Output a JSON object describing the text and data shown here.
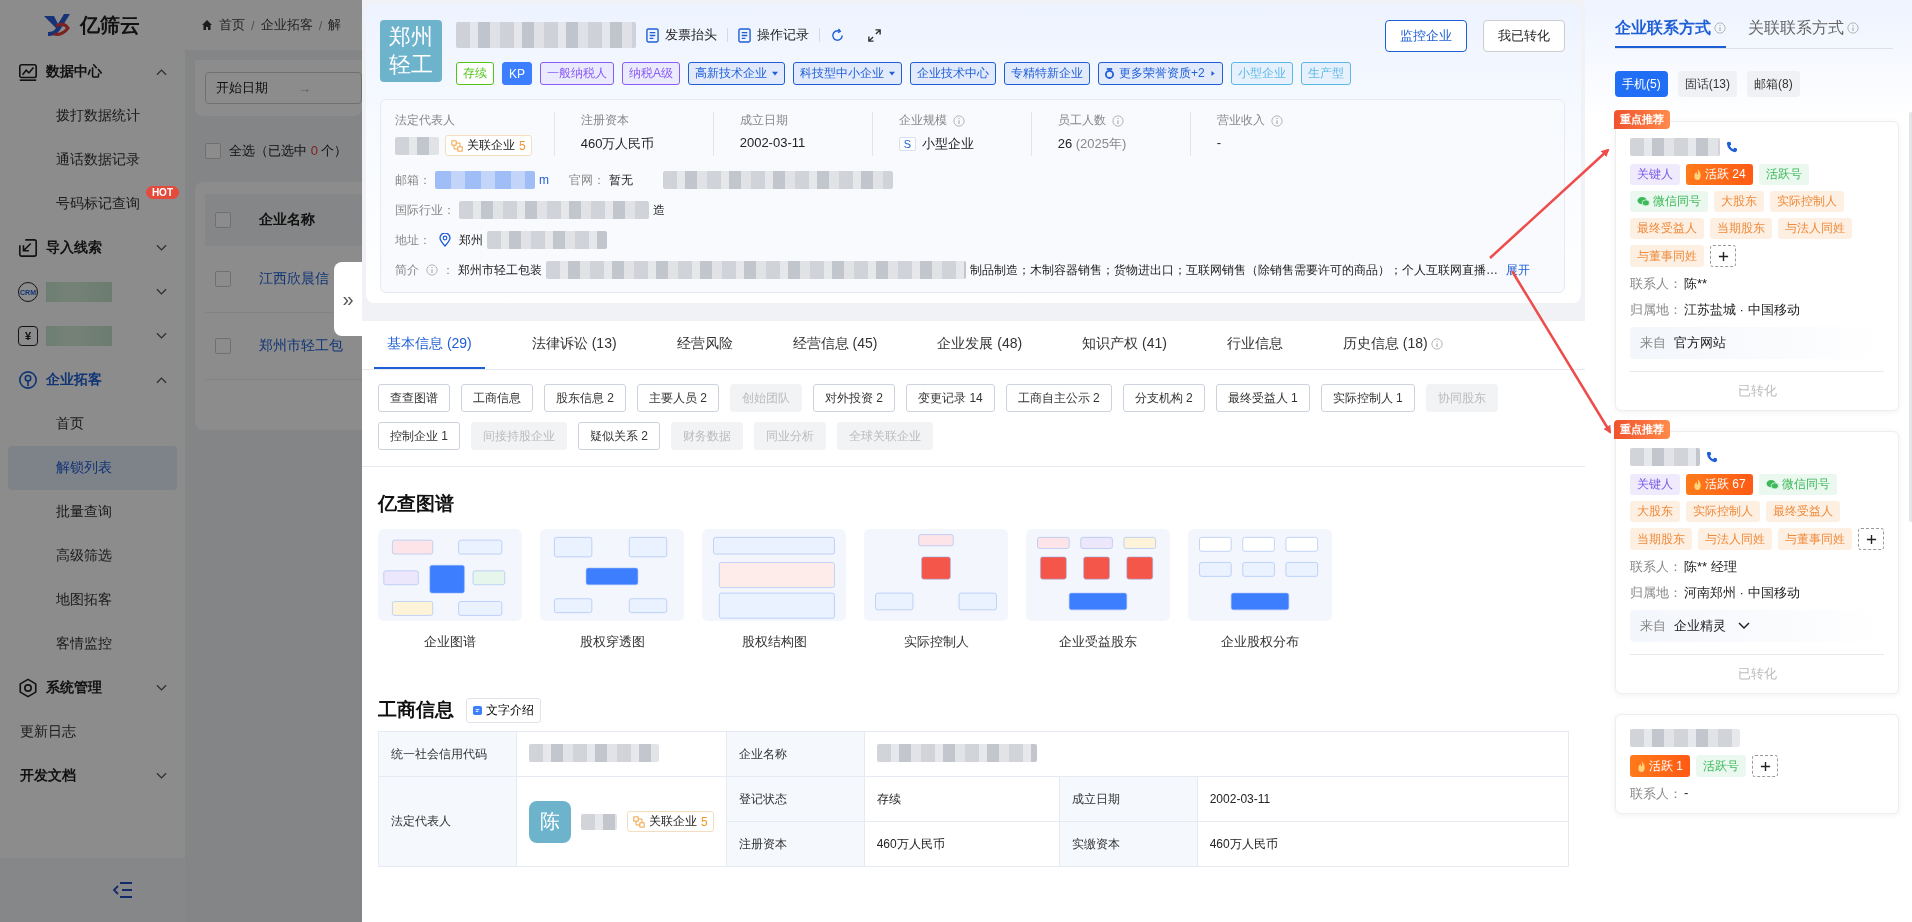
{
  "sidebar": {
    "logo": "亿筛云",
    "menu": [
      {
        "kind": "group",
        "label": "数据中心",
        "expanded": true,
        "active": false,
        "children": [
          {
            "label": "拨打数据统计",
            "selected": false
          },
          {
            "label": "通话数据记录",
            "selected": false
          },
          {
            "label": "号码标记查询",
            "selected": false,
            "badge": "HOT"
          }
        ]
      },
      {
        "kind": "group",
        "label": "导入线索",
        "expanded": false,
        "active": false
      },
      {
        "kind": "group",
        "icon_text": "CRM",
        "expanded": false
      },
      {
        "kind": "group",
        "icon_text": "¥",
        "expanded": false
      },
      {
        "kind": "group",
        "label": "企业拓客",
        "expanded": true,
        "active": true,
        "children": [
          {
            "label": "首页",
            "selected": false
          },
          {
            "label": "解锁列表",
            "selected": true
          },
          {
            "label": "批量查询",
            "selected": false
          },
          {
            "label": "高级筛选",
            "selected": false
          },
          {
            "label": "地图拓客",
            "selected": false
          },
          {
            "label": "客情监控",
            "selected": false
          }
        ]
      },
      {
        "kind": "group",
        "label": "系统管理",
        "expanded": false,
        "active": false
      },
      {
        "kind": "link",
        "label": "更新日志"
      },
      {
        "kind": "section",
        "label": "开发文档",
        "expanded": false
      }
    ]
  },
  "background": {
    "breadcrumb": [
      "首页",
      "企业拓客",
      "解"
    ],
    "breadcrumb_separator": "/",
    "date_start": "开始日期",
    "date_arrow": "→",
    "select_all": {
      "prefix": "全选（已选中",
      "count": "0",
      "suffix": "个）",
      "checked": false
    },
    "table": {
      "column": "企业名称",
      "header_checked": false,
      "rows": [
        {
          "label": "江西欣晨信",
          "checked": false
        },
        {
          "label": "郑州市轻工包",
          "checked": false
        }
      ]
    }
  },
  "drawer_handle": "»",
  "company": {
    "logo_text": "郑州轻工",
    "actions": [
      {
        "label": "发票抬头"
      },
      {
        "label": "操作记录"
      }
    ],
    "buttons": [
      {
        "label": "监控企业",
        "kind": "primary"
      },
      {
        "label": "我已转化",
        "kind": "default"
      }
    ],
    "tags": [
      {
        "label": "存续",
        "kind": "outline",
        "color": "#52c41a",
        "dropdown": false
      },
      {
        "label": "KP",
        "kind": "solid",
        "color": "#3d7eff",
        "dropdown": false
      },
      {
        "label": "一般纳税人",
        "kind": "light",
        "color": "#8a5cf6",
        "dropdown": false
      },
      {
        "label": "纳税A级",
        "kind": "light",
        "color": "#8a5cf6",
        "dropdown": false
      },
      {
        "label": "高新技术企业",
        "kind": "light",
        "color": "#1f5fd6",
        "dropdown": true
      },
      {
        "label": "科技型中小企业",
        "kind": "light",
        "color": "#1f5fd6",
        "dropdown": true
      },
      {
        "label": "企业技术中心",
        "kind": "light",
        "color": "#1f5fd6",
        "dropdown": false
      },
      {
        "label": "专精特新企业",
        "kind": "light",
        "color": "#1f5fd6",
        "dropdown": false
      },
      {
        "label": "更多荣誉资质+2",
        "kind": "more",
        "color": "#1f5fd6",
        "dropdown": false
      },
      {
        "label": "小型企业",
        "kind": "light",
        "color": "#5cb8e6",
        "dropdown": false
      },
      {
        "label": "生产型",
        "kind": "light",
        "color": "#5cb8e6",
        "dropdown": false
      }
    ],
    "fields": [
      {
        "label": "法定代表人",
        "kind": "person",
        "hint": false,
        "related_label": "关联企业",
        "related_count": "5"
      },
      {
        "label": "注册资本",
        "kind": "text",
        "hint": false,
        "value": "460万人民币"
      },
      {
        "label": "成立日期",
        "kind": "text",
        "hint": false,
        "value": "2002-03-11"
      },
      {
        "label": "企业规模",
        "kind": "scale",
        "hint": true,
        "badge": "S",
        "value": "小型企业"
      },
      {
        "label": "员工人数",
        "kind": "text",
        "hint": true,
        "value": "26",
        "note": "(2025年)"
      },
      {
        "label": "营业收入",
        "kind": "text",
        "hint": true,
        "value": "-"
      }
    ],
    "email": {
      "label": "邮箱：",
      "tail": "m"
    },
    "website": {
      "label": "官网：",
      "value": "暂无"
    },
    "industry": {
      "label": "国际行业：",
      "tail": "造"
    },
    "address": {
      "label": "地址：",
      "value": "郑州"
    },
    "intro": {
      "label": "简介",
      "colon": "：",
      "prefix": "郑州市轻工包装",
      "text": "制品制造；木制容器销售；货物进出口；互联网销售（除销售需要许可的商品）；个人互联网直播…",
      "more": "展开"
    }
  },
  "tabs": [
    {
      "label": "基本信息 (29)",
      "selected": true,
      "hint": false
    },
    {
      "label": "法律诉讼 (13)",
      "selected": false,
      "hint": false
    },
    {
      "label": "经营风险",
      "selected": false,
      "hint": false
    },
    {
      "label": "经营信息 (45)",
      "selected": false,
      "hint": false
    },
    {
      "label": "企业发展 (48)",
      "selected": false,
      "hint": false
    },
    {
      "label": "知识产权 (41)",
      "selected": false,
      "hint": false
    },
    {
      "label": "行业信息",
      "selected": false,
      "hint": false
    },
    {
      "label": "历史信息 (18)",
      "selected": false,
      "hint": true
    }
  ],
  "sections": [
    {
      "label": "查查图谱",
      "disabled": false
    },
    {
      "label": "工商信息",
      "disabled": false
    },
    {
      "label": "股东信息 2",
      "disabled": false
    },
    {
      "label": "主要人员 2",
      "disabled": false
    },
    {
      "label": "创始团队",
      "disabled": true
    },
    {
      "label": "对外投资 2",
      "disabled": false
    },
    {
      "label": "变更记录 14",
      "disabled": false
    },
    {
      "label": "工商自主公示 2",
      "disabled": false
    },
    {
      "label": "分支机构 2",
      "disabled": false
    },
    {
      "label": "最终受益人 1",
      "disabled": false
    },
    {
      "label": "实际控制人 1",
      "disabled": false
    },
    {
      "label": "协同股东",
      "disabled": true
    },
    {
      "label": "控制企业 1",
      "disabled": false
    },
    {
      "label": "间接持股企业",
      "disabled": true
    },
    {
      "label": "疑似关系 2",
      "disabled": false
    },
    {
      "label": "财务数据",
      "disabled": true
    },
    {
      "label": "同业分析",
      "disabled": true
    },
    {
      "label": "全球关联企业",
      "disabled": true
    }
  ],
  "graphs": {
    "title": "亿查图谱",
    "items": [
      {
        "label": "企业图谱"
      },
      {
        "label": "股权穿透图"
      },
      {
        "label": "股权结构图"
      },
      {
        "label": "实际控制人"
      },
      {
        "label": "企业受益股东"
      },
      {
        "label": "企业股权分布"
      }
    ]
  },
  "business": {
    "title": "工商信息",
    "intro_button": "文字介绍",
    "credit_code_label": "统一社会信用代码",
    "name_label": "企业名称",
    "legal_label": "法定代表人",
    "legal_avatar": "陈",
    "legal_related_label": "关联企业",
    "legal_related_count": "5",
    "cells": [
      {
        "label": "登记状态",
        "value": "存续"
      },
      {
        "label": "成立日期",
        "value": "2002-03-11"
      },
      {
        "label": "注册资本",
        "value": "460万人民币"
      },
      {
        "label": "实缴资本",
        "value": "460万人民币"
      }
    ]
  },
  "contacts": {
    "tabs": [
      {
        "label": "企业联系方式",
        "selected": true
      },
      {
        "label": "关联联系方式",
        "selected": false
      }
    ],
    "filters": [
      {
        "label": "手机(5)",
        "selected": true
      },
      {
        "label": "固话(13)",
        "selected": false
      },
      {
        "label": "邮箱(8)",
        "selected": false
      }
    ],
    "cards": [
      {
        "recommended": true,
        "recommend_label": "重点推荐",
        "tags": [
          {
            "kind": "key",
            "label": "关键人"
          },
          {
            "kind": "active",
            "label": "活跃 24"
          },
          {
            "kind": "green",
            "label": "活跃号"
          },
          {
            "kind": "wechat",
            "label": "微信同号"
          },
          {
            "kind": "relation",
            "label": "大股东"
          },
          {
            "kind": "relation",
            "label": "实际控制人"
          },
          {
            "kind": "relation",
            "label": "最终受益人"
          },
          {
            "kind": "relation",
            "label": "当期股东"
          },
          {
            "kind": "relation",
            "label": "与法人同姓"
          },
          {
            "kind": "relation",
            "label": "与董事同姓"
          }
        ],
        "contact_label": "联系人：",
        "contact": "陈**",
        "region_label": "归属地：",
        "region": "江苏盐城 · 中国移动",
        "source_label": "来自",
        "source": "官方网站",
        "expandable": false,
        "status": "已转化"
      },
      {
        "recommended": true,
        "recommend_label": "重点推荐",
        "tags": [
          {
            "kind": "key",
            "label": "关键人"
          },
          {
            "kind": "active",
            "label": "活跃 67"
          },
          {
            "kind": "wechat",
            "label": "微信同号"
          },
          {
            "kind": "relation",
            "label": "大股东"
          },
          {
            "kind": "relation",
            "label": "实际控制人"
          },
          {
            "kind": "relation",
            "label": "最终受益人"
          },
          {
            "kind": "relation",
            "label": "当期股东"
          },
          {
            "kind": "relation",
            "label": "与法人同姓"
          },
          {
            "kind": "relation",
            "label": "与董事同姓"
          }
        ],
        "contact_label": "联系人：",
        "contact": "陈** 经理",
        "region_label": "归属地：",
        "region": "河南郑州 · 中国移动",
        "source_label": "来自",
        "source": "企业精灵",
        "expandable": true,
        "status": "已转化"
      },
      {
        "recommended": false,
        "tags": [
          {
            "kind": "active",
            "label": "活跃 1"
          },
          {
            "kind": "green",
            "label": "活跃号"
          }
        ],
        "contact_label": "联系人：",
        "contact": "-"
      }
    ]
  }
}
